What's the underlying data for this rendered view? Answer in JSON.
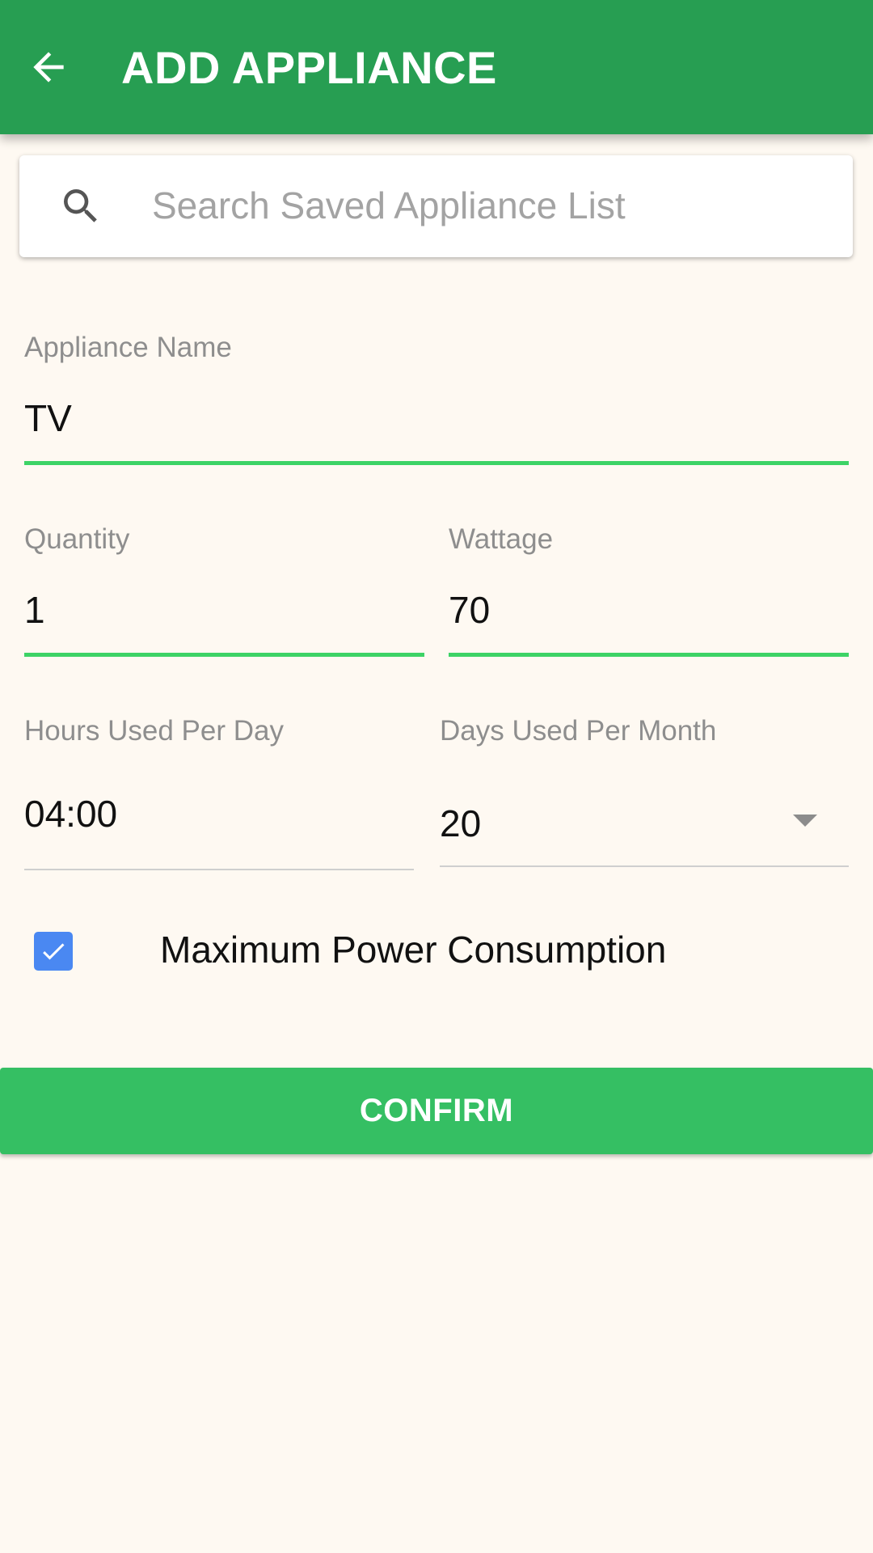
{
  "theme": {
    "appbar_color": "#279E52",
    "accent_green": "#3DD366",
    "button_color": "#35BF63",
    "checkbox_color": "#4A88F2",
    "background": "#FEF9F2"
  },
  "appbar": {
    "back_icon": "arrow-left-icon",
    "title": "ADD APPLIANCE"
  },
  "search": {
    "icon": "search-icon",
    "placeholder": "Search Saved Appliance List",
    "value": ""
  },
  "form": {
    "appliance_name": {
      "label": "Appliance Name",
      "value": "TV"
    },
    "quantity": {
      "label": "Quantity",
      "value": "1"
    },
    "wattage": {
      "label": "Wattage",
      "value": "70"
    },
    "hours_per_day": {
      "label": "Hours Used Per Day",
      "value": "04:00"
    },
    "days_per_month": {
      "label": "Days Used Per Month",
      "value": "20"
    },
    "max_power": {
      "label": "Maximum Power Consumption",
      "checked": true
    }
  },
  "confirm_label": "CONFIRM"
}
